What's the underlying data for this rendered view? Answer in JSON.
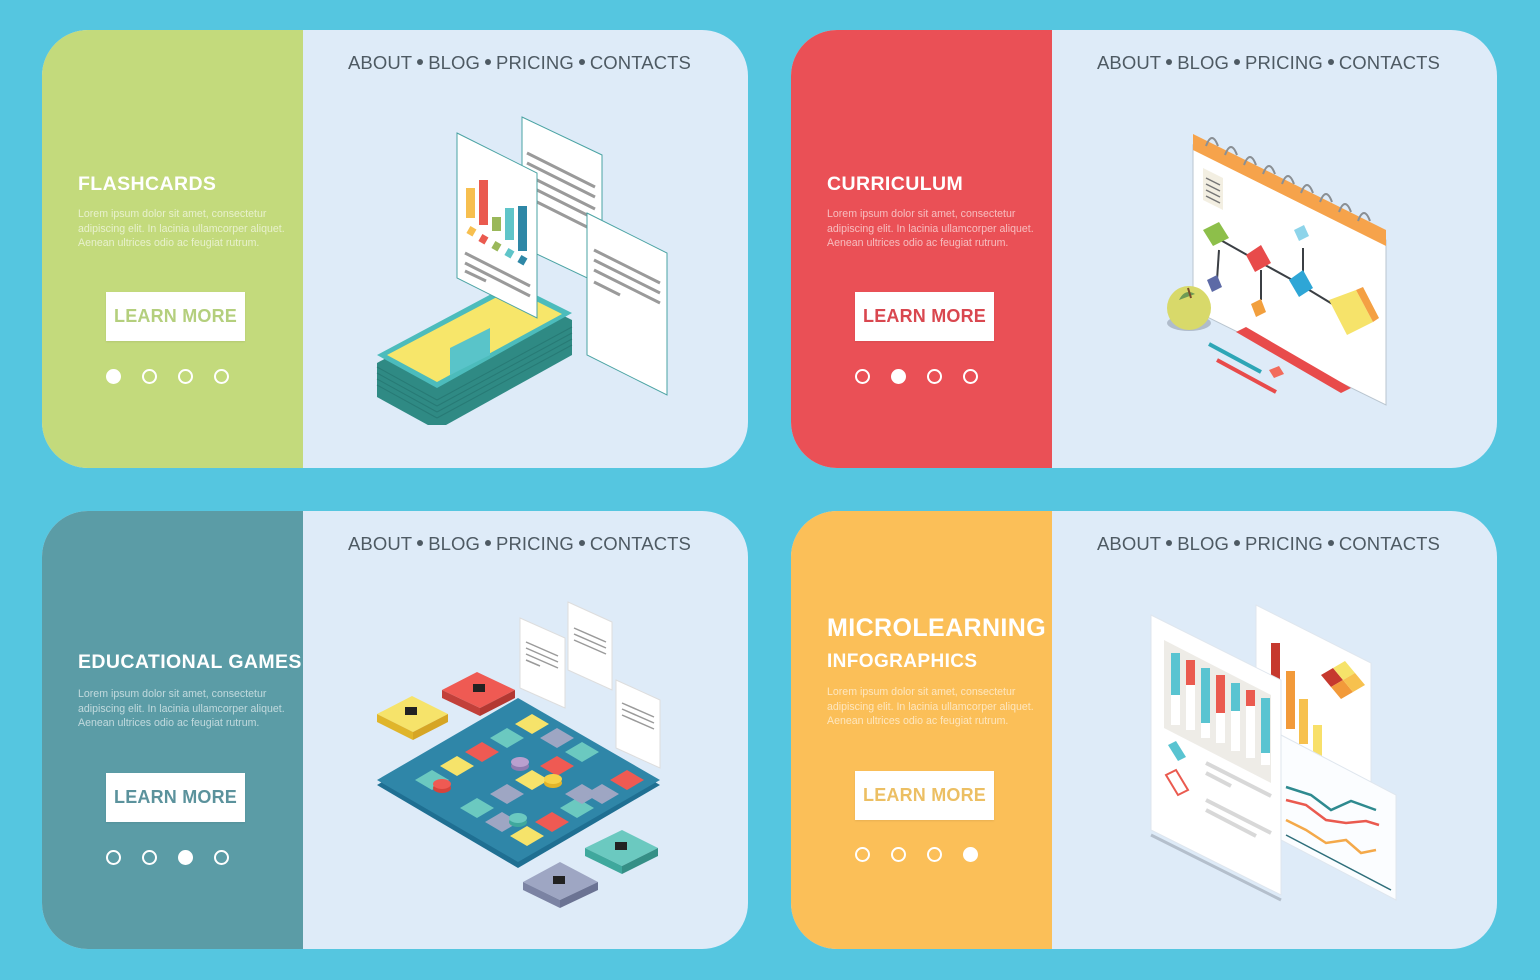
{
  "background_color": "#55c6e0",
  "nav": {
    "items": [
      "ABOUT",
      "BLOG",
      "PRICING",
      "CONTACTS"
    ]
  },
  "cards": [
    {
      "title": "FLASHCARDS",
      "subtitle": "",
      "description": "Lorem ipsum dolor sit amet, consectetur adipiscing elit. In lacinia ullamcorper aliquet. Aenean ultrices odio ac feugiat rutrum.",
      "button_label": "LEARN MORE",
      "accent_color": "#c3da7c",
      "button_text_color": "#b4cf7d",
      "active_slide": 1,
      "total_slides": 4,
      "illustration": "flashcards-illustration"
    },
    {
      "title": "CURRICULUM",
      "subtitle": "",
      "description": "Lorem ipsum dolor sit amet, consectetur adipiscing elit. In lacinia ullamcorper aliquet. Aenean ultrices odio ac feugiat rutrum.",
      "button_label": "LEARN MORE",
      "accent_color": "#ea5056",
      "button_text_color": "#d9474f",
      "active_slide": 2,
      "total_slides": 4,
      "illustration": "curriculum-illustration"
    },
    {
      "title": "EDUCATIONAL GAMES",
      "subtitle": "",
      "description": "Lorem ipsum dolor sit amet, consectetur adipiscing elit. In lacinia ullamcorper aliquet. Aenean ultrices odio ac feugiat rutrum.",
      "button_label": "LEARN MORE",
      "accent_color": "#5b9ca6",
      "button_text_color": "#5b929c",
      "active_slide": 3,
      "total_slides": 4,
      "illustration": "board-game-illustration"
    },
    {
      "title": "MICROLEARNING",
      "subtitle": "INFOGRAPHICS",
      "description": "Lorem ipsum dolor sit amet, consectetur adipiscing elit. In lacinia ullamcorper aliquet. Aenean ultrices odio ac feugiat rutrum.",
      "button_label": "LEARN MORE",
      "accent_color": "#fbbf58",
      "button_text_color": "#ecbf63",
      "active_slide": 4,
      "total_slides": 4,
      "illustration": "infographics-illustration"
    }
  ]
}
